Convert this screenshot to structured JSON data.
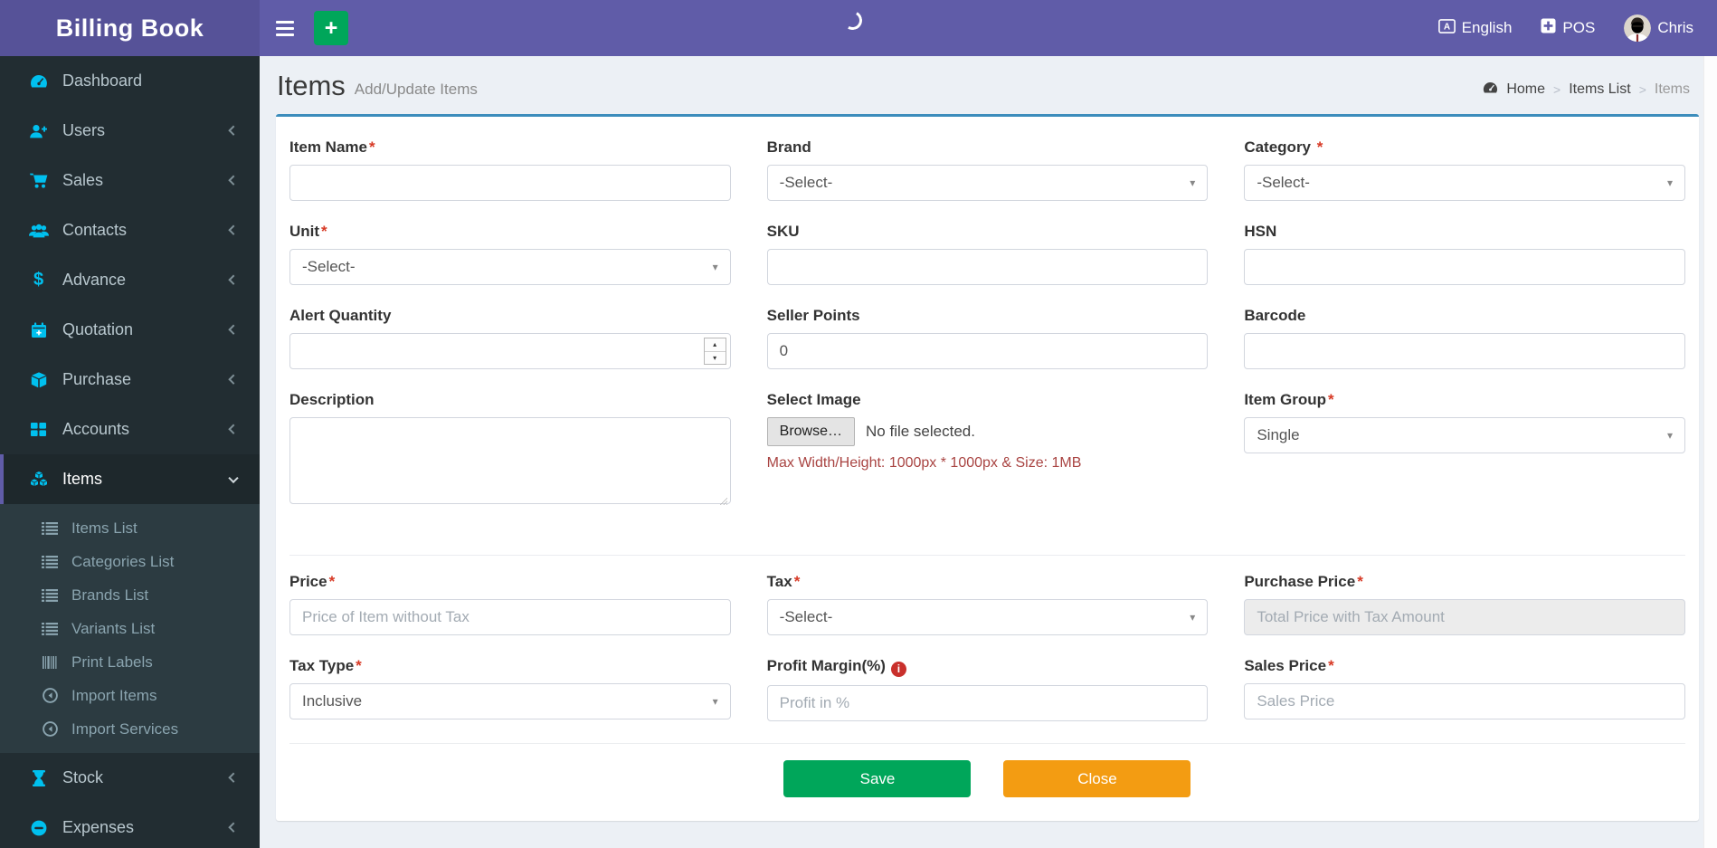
{
  "app": {
    "title": "Billing Book"
  },
  "header": {
    "language_label": "English",
    "pos_label": "POS",
    "user_name": "Chris"
  },
  "icons": {
    "plus": "+",
    "dollar": "$",
    "info": "i",
    "lang_a": "A",
    "caret": "▾",
    "spin_up": "▴",
    "spin_down": "▾"
  },
  "colors": {
    "navbar_purple": "#605ca8",
    "logo_purple": "#565298",
    "sidebar_dark": "#222d32",
    "submenu_dark": "#2c3b41",
    "icon_cyan": "#00c0ef",
    "card_top_blue": "#3c8dbc",
    "save_green": "#00a65a",
    "close_orange": "#f39c12",
    "required_red": "#d73925",
    "note_red": "#a94442"
  },
  "sidebar": {
    "items": [
      {
        "label": "Dashboard"
      },
      {
        "label": "Users"
      },
      {
        "label": "Sales"
      },
      {
        "label": "Contacts"
      },
      {
        "label": "Advance"
      },
      {
        "label": "Quotation"
      },
      {
        "label": "Purchase"
      },
      {
        "label": "Accounts"
      },
      {
        "label": "Items",
        "active": true,
        "children": [
          {
            "label": "Items List"
          },
          {
            "label": "Categories List"
          },
          {
            "label": "Brands List"
          },
          {
            "label": "Variants List"
          },
          {
            "label": "Print Labels"
          },
          {
            "label": "Import Items"
          },
          {
            "label": "Import Services"
          }
        ]
      },
      {
        "label": "Stock"
      },
      {
        "label": "Expenses"
      }
    ]
  },
  "page": {
    "title": "Items",
    "subtitle": "Add/Update Items",
    "breadcrumb": [
      "Home",
      "Items List",
      "Items"
    ],
    "breadcrumb_sep": ">"
  },
  "form": {
    "required_marker": "*",
    "item_name": {
      "label": "Item Name"
    },
    "brand": {
      "label": "Brand",
      "value": "-Select-"
    },
    "category": {
      "label": "Category",
      "value": "-Select-"
    },
    "unit": {
      "label": "Unit",
      "value": "-Select-"
    },
    "sku": {
      "label": "SKU"
    },
    "hsn": {
      "label": "HSN"
    },
    "alert_quantity": {
      "label": "Alert Quantity"
    },
    "seller_points": {
      "label": "Seller Points",
      "value": "0"
    },
    "barcode": {
      "label": "Barcode"
    },
    "description": {
      "label": "Description"
    },
    "select_image": {
      "label": "Select Image",
      "browse_label": "Browse…",
      "no_file_text": "No file selected.",
      "note": "Max Width/Height: 1000px * 1000px & Size: 1MB"
    },
    "item_group": {
      "label": "Item Group",
      "value": "Single"
    },
    "price": {
      "label": "Price",
      "placeholder": "Price of Item without Tax"
    },
    "tax": {
      "label": "Tax",
      "value": "-Select-"
    },
    "purchase_price": {
      "label": "Purchase Price",
      "placeholder": "Total Price with Tax Amount"
    },
    "tax_type": {
      "label": "Tax Type",
      "value": "Inclusive"
    },
    "profit_margin": {
      "label": "Profit Margin(%)",
      "placeholder": "Profit in %"
    },
    "sales_price": {
      "label": "Sales Price",
      "placeholder": "Sales Price"
    },
    "save_label": "Save",
    "close_label": "Close"
  }
}
